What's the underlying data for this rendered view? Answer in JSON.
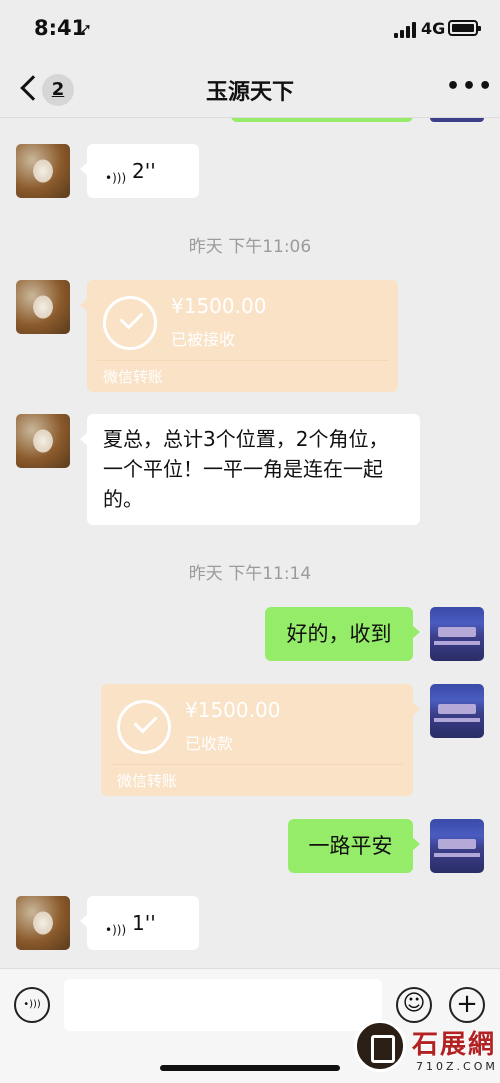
{
  "status_bar": {
    "time": "8:41",
    "network": "4G"
  },
  "nav": {
    "unread_count": "2",
    "title": "玉源天下",
    "more_label": "•••"
  },
  "messages": {
    "voice_1": {
      "duration": "2''",
      "wave": "•)))"
    },
    "timestamp_1": "昨天 下午11:06",
    "transfer_1": {
      "amount": "¥1500.00",
      "status": "已被接收",
      "source": "微信转账"
    },
    "text_1": "夏总，总计3个位置，2个角位，一个平位！一平一角是连在一起的。",
    "timestamp_2": "昨天 下午11:14",
    "reply_1": "好的，收到",
    "transfer_2": {
      "amount": "¥1500.00",
      "status": "已收款",
      "source": "微信转账"
    },
    "reply_2": "一路平安",
    "voice_2": {
      "duration": "1''",
      "wave": "•)))"
    }
  },
  "input_bar": {
    "voice_toggle": "•)))",
    "emoji": "☺",
    "plus": "+"
  },
  "watermark": {
    "text": "石展網",
    "sub": "710Z.COM"
  }
}
